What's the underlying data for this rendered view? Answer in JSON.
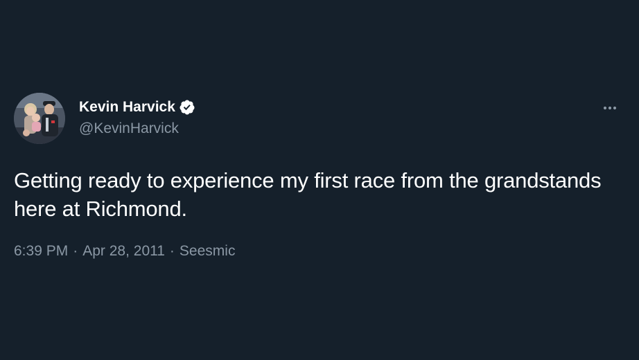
{
  "tweet": {
    "author": {
      "display_name": "Kevin Harvick",
      "handle": "@KevinHarvick",
      "verified_icon": "verified-badge-icon",
      "avatar": "profile-photo"
    },
    "more_icon": "more-horizontal-icon",
    "text": "Getting ready to experience my first race from the grandstands here at Richmond.",
    "time": "6:39 PM",
    "date": "Apr 28, 2011",
    "source": "Seesmic",
    "separator": "·"
  },
  "colors": {
    "background": "#15202b",
    "primary_text": "#ffffff",
    "secondary_text": "#8b98a5"
  }
}
